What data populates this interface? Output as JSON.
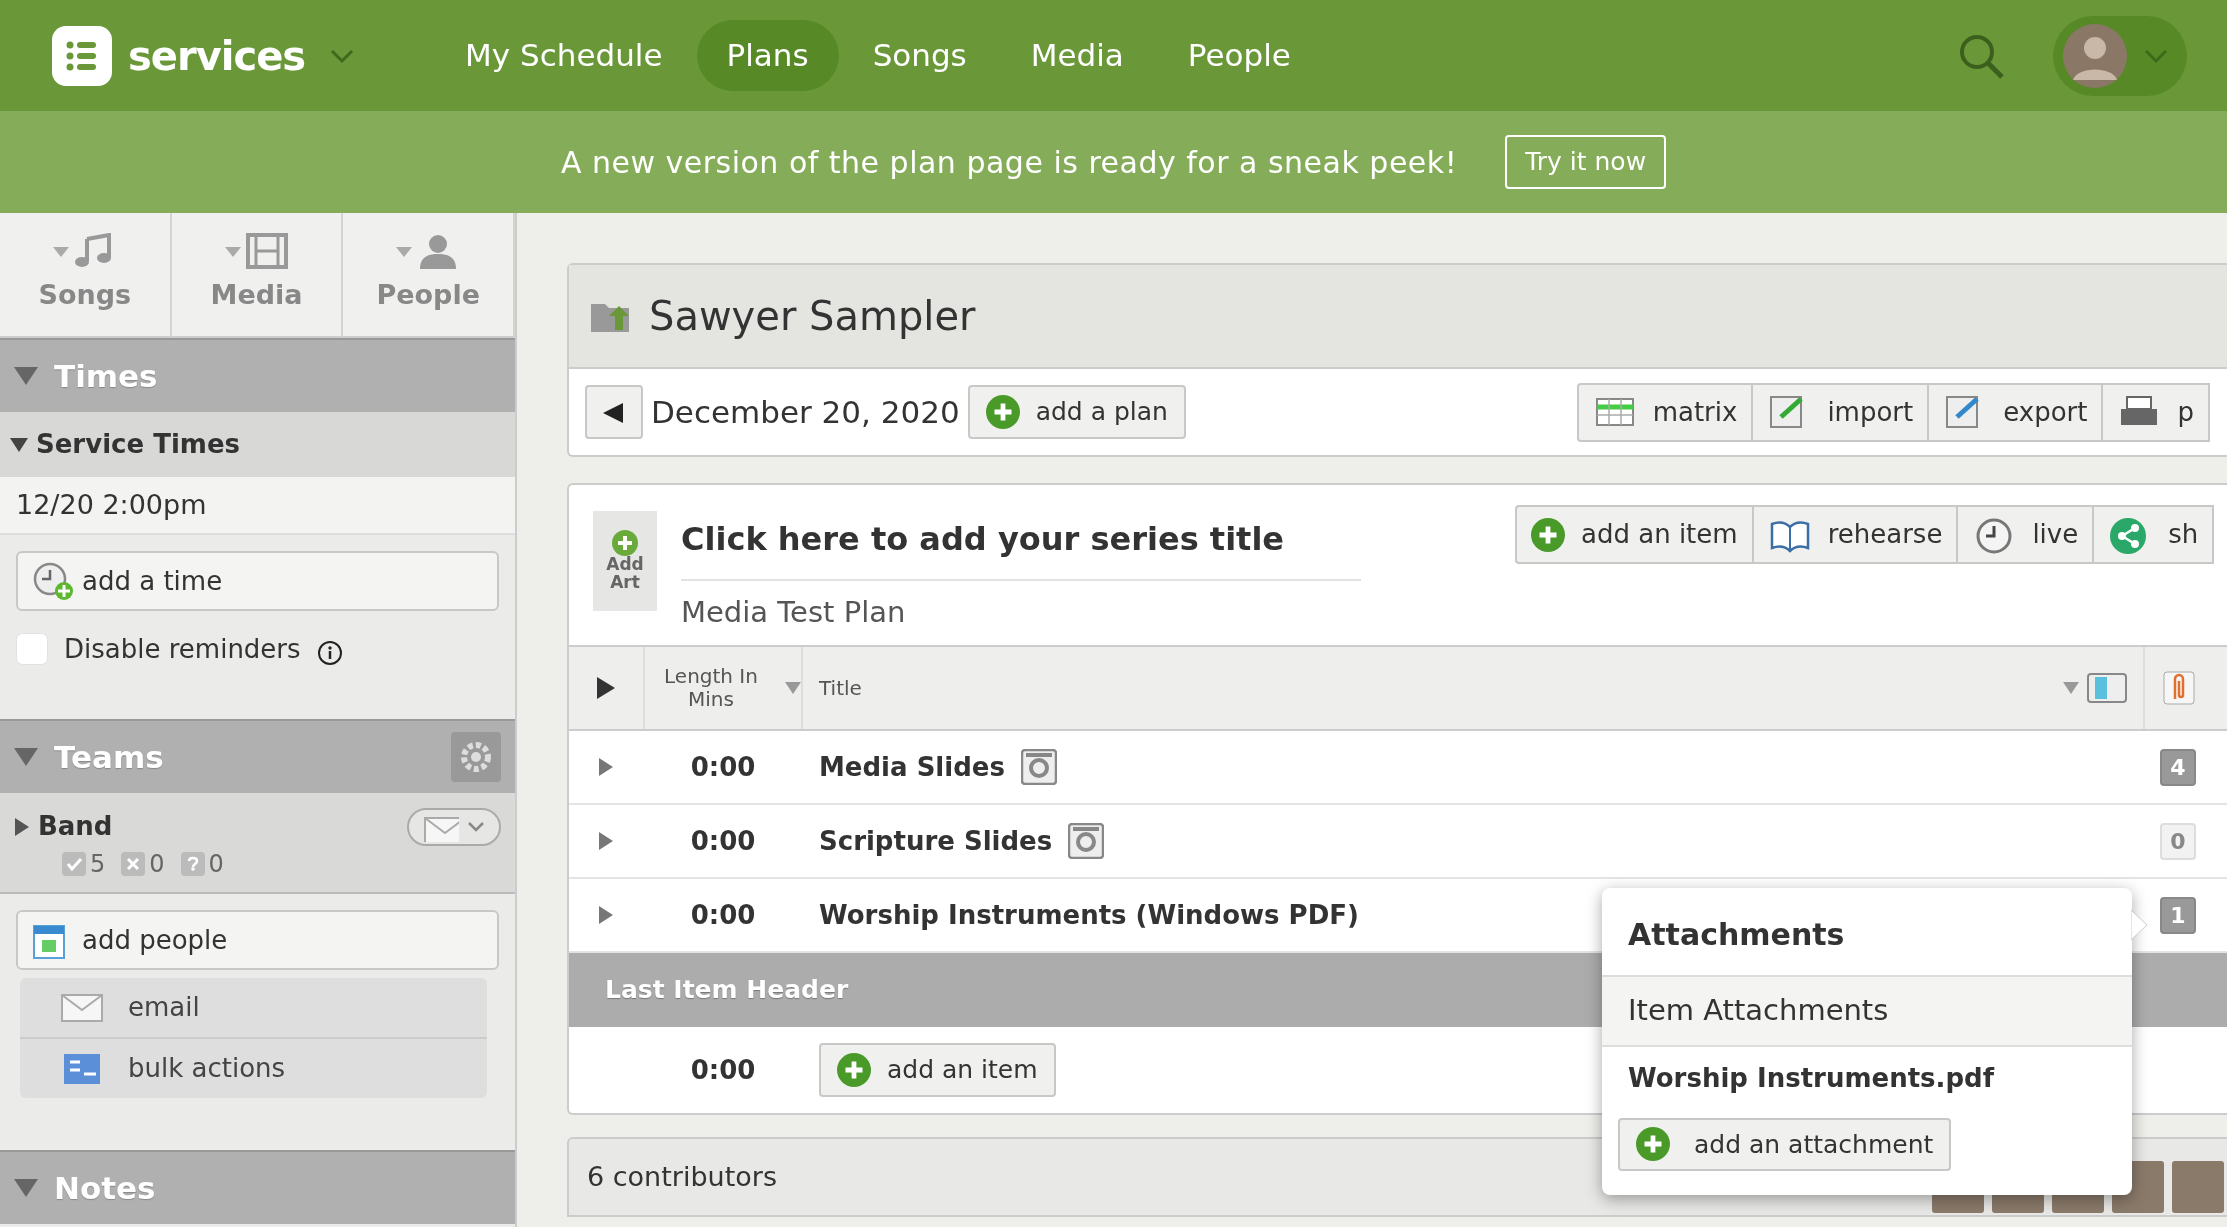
{
  "nav": {
    "brand": "services",
    "items": [
      {
        "label": "My Schedule",
        "selected": false
      },
      {
        "label": "Plans",
        "selected": true
      },
      {
        "label": "Songs",
        "selected": false
      },
      {
        "label": "Media",
        "selected": false
      },
      {
        "label": "People",
        "selected": false
      }
    ]
  },
  "banner": {
    "text": "A new version of the plan page is ready for a sneak peek!",
    "button": "Try it now"
  },
  "sidebar": {
    "tabs": [
      {
        "label": "Songs",
        "kind": "music"
      },
      {
        "label": "Media",
        "kind": "film"
      },
      {
        "label": "People",
        "kind": "person"
      }
    ],
    "times": {
      "title": "Times",
      "group": "Service Times",
      "entries": [
        "12/20 2:00pm"
      ],
      "add_button": "add a time",
      "reminders": {
        "label": "Disable reminders",
        "checked": false
      }
    },
    "teams": {
      "title": "Teams",
      "list": [
        {
          "name": "Band",
          "expanded": false,
          "confirmed": "5",
          "declined": "0",
          "unknown": "0"
        }
      ],
      "add_button": "add people",
      "actions": [
        {
          "label": "email",
          "kind": "mail"
        },
        {
          "label": "bulk actions",
          "kind": "bulk"
        }
      ]
    },
    "notes": {
      "title": "Notes"
    }
  },
  "plan": {
    "series": "Sawyer Sampler",
    "date": "December 20, 2020",
    "add_plan": "add a plan",
    "tools": [
      {
        "label": "matrix",
        "kind": "matrix"
      },
      {
        "label": "import",
        "kind": "import"
      },
      {
        "label": "export",
        "kind": "export"
      },
      {
        "label": "p",
        "kind": "print"
      }
    ],
    "add_art": "Add Art",
    "series_title": "Click here to add your series title",
    "plan_title": "Media Test Plan",
    "actions": [
      {
        "label": "add an item",
        "kind": "add"
      },
      {
        "label": "rehearse",
        "kind": "book"
      },
      {
        "label": "live",
        "kind": "clock"
      },
      {
        "label": "sh",
        "kind": "share"
      }
    ]
  },
  "table": {
    "columns": [
      "Length In Mins",
      "Title"
    ],
    "rows": [
      {
        "kind": "item",
        "length": "0:00",
        "title": "Media Slides",
        "has_media": true,
        "attachments": "4",
        "has_attachments": true
      },
      {
        "kind": "item",
        "length": "0:00",
        "title": "Scripture Slides",
        "has_media": true,
        "attachments": "0",
        "has_attachments": false
      },
      {
        "kind": "item",
        "length": "0:00",
        "title": "Worship Instruments (Windows PDF)",
        "has_media": false,
        "attachments": "1",
        "has_attachments": true
      },
      {
        "kind": "header",
        "title": "Last Item Header"
      },
      {
        "kind": "add",
        "length": "0:00",
        "button": "add an item"
      }
    ]
  },
  "contributors": {
    "label": "6 contributors",
    "avatars": [
      {
        "kind": "photo"
      },
      {
        "kind": "photo"
      },
      {
        "kind": "photo"
      },
      {
        "kind": "photo"
      },
      {
        "kind": "photo"
      }
    ]
  },
  "popover": {
    "title": "Attachments",
    "section": "Item Attachments",
    "files": [
      "Worship Instruments.pdf"
    ],
    "button": "add an attachment"
  }
}
